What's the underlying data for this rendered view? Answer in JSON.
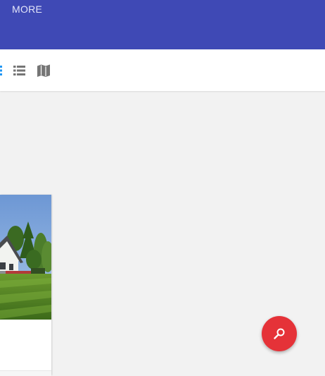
{
  "appbar": {
    "more_label": "MORE",
    "color": "#3f49b5"
  },
  "toolbar": {
    "views": [
      {
        "name": "grid",
        "icon": "grid-view-icon",
        "active": true,
        "color": "#2196f3"
      },
      {
        "name": "list",
        "icon": "list-view-icon",
        "active": false,
        "color": "#757575"
      },
      {
        "name": "map",
        "icon": "map-view-icon",
        "active": false,
        "color": "#757575"
      }
    ]
  },
  "listing_card": {
    "image": "house-photo"
  },
  "fab": {
    "icon": "search-icon",
    "color": "#e53238"
  }
}
